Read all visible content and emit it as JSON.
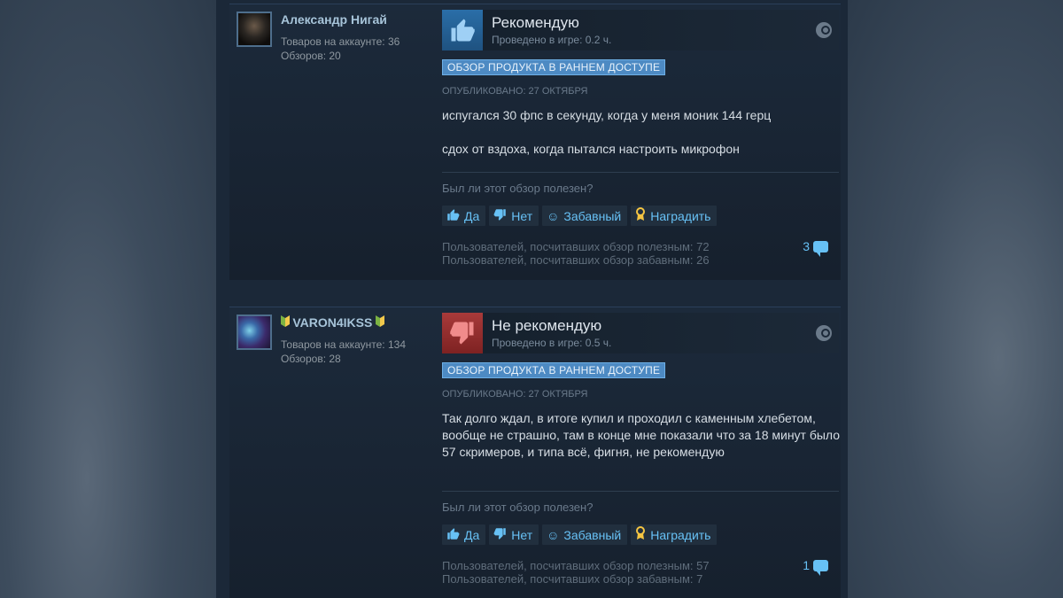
{
  "reviews": [
    {
      "author": "Александр Нигай",
      "author_leaf_left": "",
      "author_leaf_right": "",
      "products": "Товаров на аккаунте: 36",
      "reviews_count": "Обзоров: 20",
      "verdict": "Рекомендую",
      "hours": "Проведено в игре: 0.2 ч.",
      "badge": "ОБЗОР ПРОДУКТА В РАННЕМ ДОСТУПЕ",
      "posted": "ОПУБЛИКОВАНО: 27 ОКТЯБРЯ",
      "paragraphs": [
        "испугался 30 фпс в секунду, когда у меня моник 144 герц",
        "сдох от вздоха, когда пытался настроить микрофон"
      ],
      "helpful_question": "Был ли этот обзор полезен?",
      "btn_yes": "Да",
      "btn_no": "Нет",
      "btn_funny": "Забавный",
      "btn_award": "Наградить",
      "helpful_stat": "Пользователей, посчитавших обзор полезным: 72",
      "funny_stat": "Пользователей, посчитавших обзор забавным: 26",
      "comments": "3"
    },
    {
      "author": "VARON4IKSS",
      "author_leaf_left": "🔰",
      "author_leaf_right": "🔰",
      "products": "Товаров на аккаунте: 134",
      "reviews_count": "Обзоров: 28",
      "verdict": "Не рекомендую",
      "hours": "Проведено в игре: 0.5 ч.",
      "badge": "ОБЗОР ПРОДУКТА В РАННЕМ ДОСТУПЕ",
      "posted": "ОПУБЛИКОВАНО: 27 ОКТЯБРЯ",
      "paragraphs": [
        "Так долго ждал, в итоге купил и проходил с каменным хлебетом, вообще не страшно, там в конце мне показали что за 18 минут было 57 скримеров, и типа всё, фигня, не рекомендую"
      ],
      "helpful_question": "Был ли этот обзор полезен?",
      "btn_yes": "Да",
      "btn_no": "Нет",
      "btn_funny": "Забавный",
      "btn_award": "Наградить",
      "helpful_stat": "Пользователей, посчитавших обзор полезным: 57",
      "funny_stat": "Пользователей, посчитавших обзор забавным: 7",
      "comments": "1"
    }
  ],
  "icons": {
    "thumbs_up": "thumbs-up-icon",
    "thumbs_down": "thumbs-down-icon",
    "smile": "smile-icon",
    "award": "award-icon",
    "comment": "comment-bubble-icon",
    "steam": "steam-logo-icon"
  },
  "colors": {
    "background": "#1b2838",
    "link": "#67c1f5",
    "badge": "#4d8ac3",
    "recommend": "#2a6ea8",
    "not_recommend": "#a83a3a"
  }
}
